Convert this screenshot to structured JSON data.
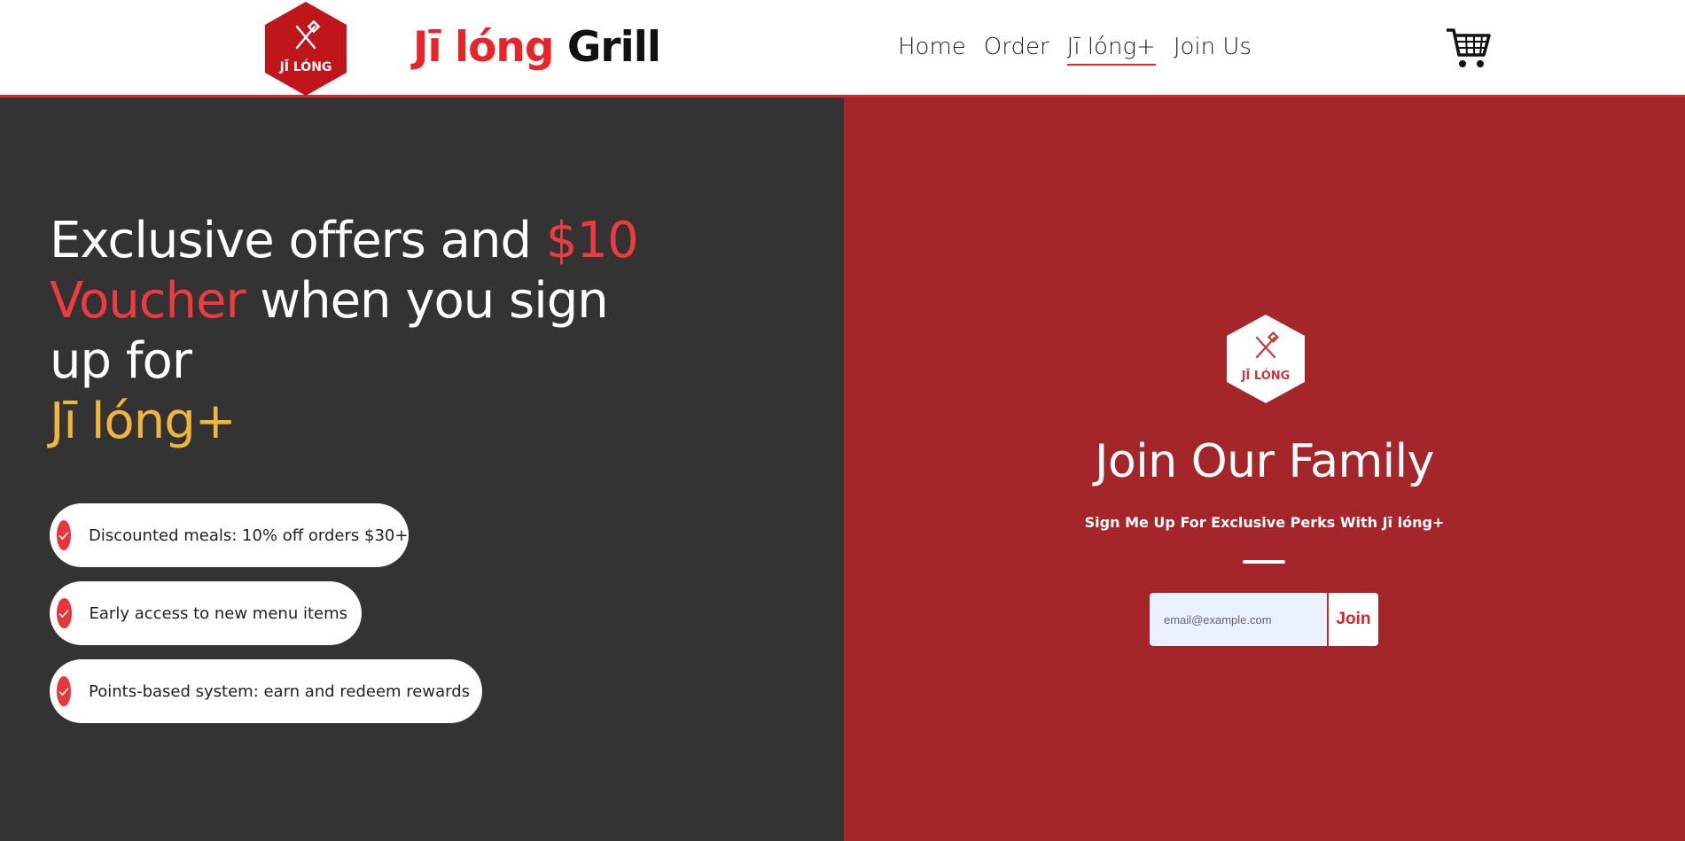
{
  "header": {
    "logo_text": "JĪ LÓNG",
    "brand_red": "Jī lóng",
    "brand_black": "Grill",
    "nav": [
      {
        "label": "Home",
        "active": false
      },
      {
        "label": "Order",
        "active": false
      },
      {
        "label": "Jī lóng+",
        "active": true
      },
      {
        "label": "Join Us",
        "active": false
      }
    ],
    "cart_icon": "shopping-cart-icon"
  },
  "hero": {
    "part1": "Exclusive offers and ",
    "part2": "$10 Voucher",
    "part3": " when you sign up for",
    "part4": "Jī lóng+"
  },
  "perks": [
    "Discounted meals: 10% off orders $30+",
    "Early access to new menu items",
    "Points-based system: earn and redeem rewards"
  ],
  "signup": {
    "logo_text": "JĪ LÓNG",
    "title": "Join Our Family",
    "subtitle": "Sign Me Up For Exclusive Perks With Jī lóng+",
    "email_placeholder": "email@example.com",
    "button": "Join"
  },
  "colors": {
    "brand_red": "#e8232a",
    "dark_panel": "#333333",
    "red_panel": "#a5262a",
    "gold": "#f0b53c"
  }
}
